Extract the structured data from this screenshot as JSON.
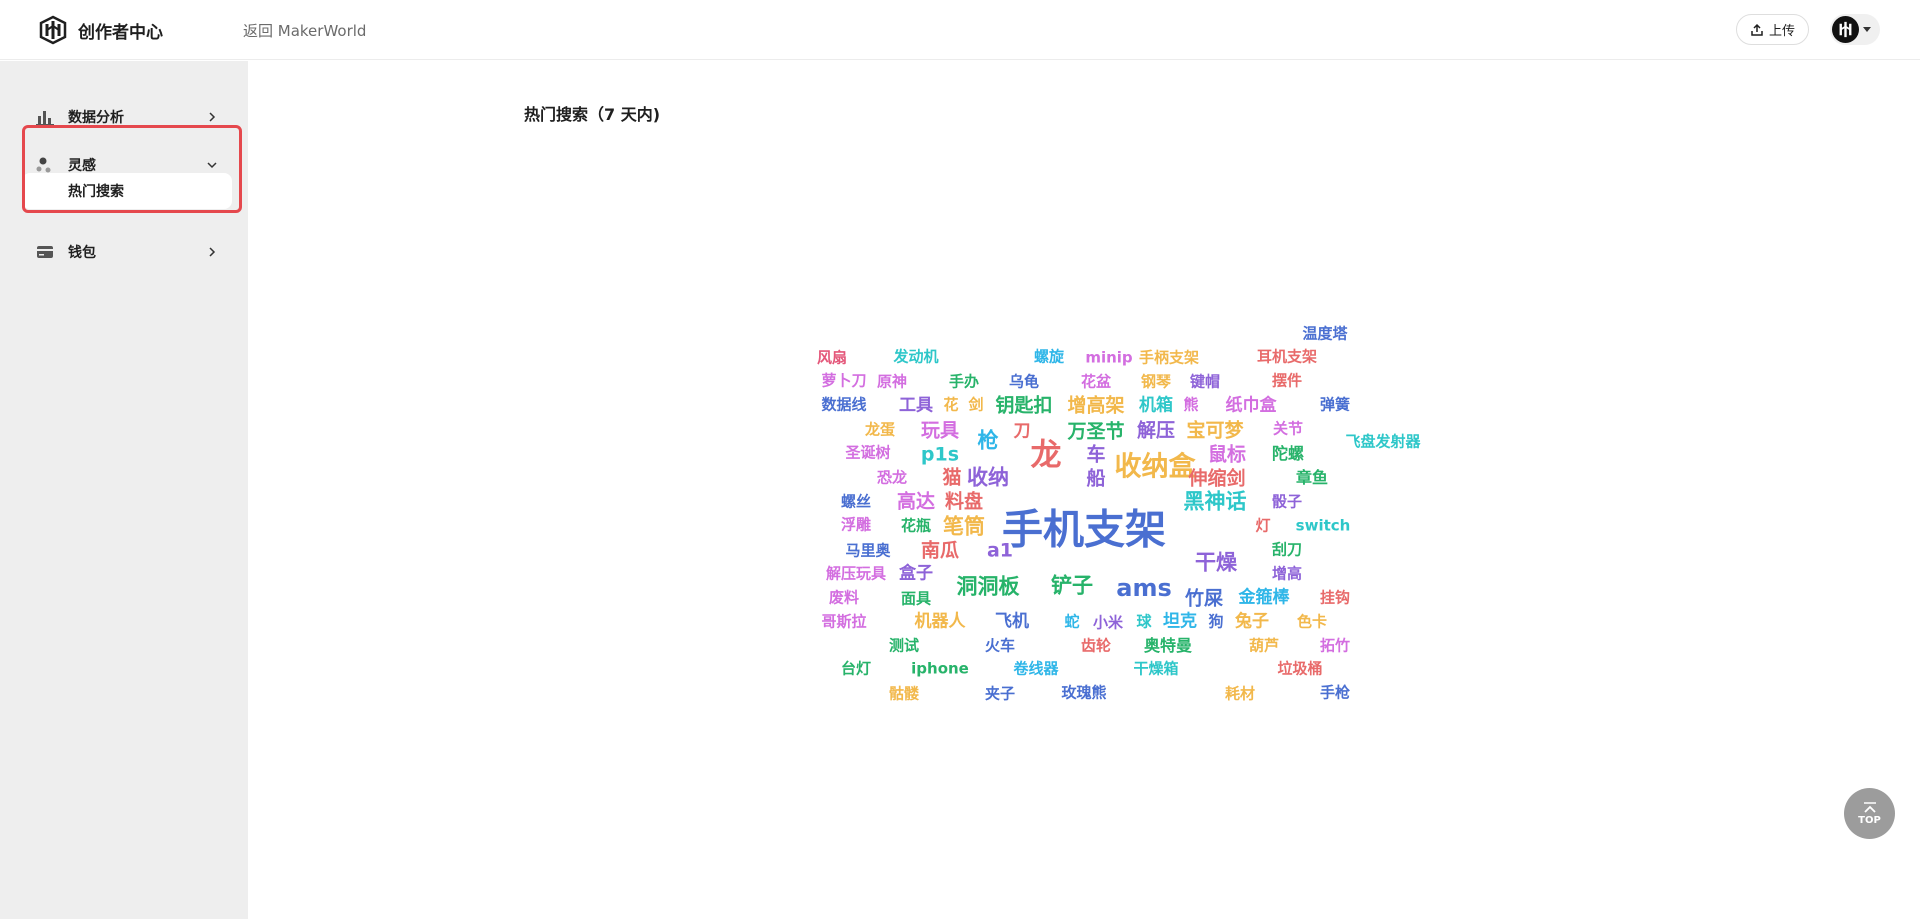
{
  "header": {
    "app_title": "创作者中心",
    "back_link": "返回 MakerWorld",
    "upload_label": "上传"
  },
  "sidebar": {
    "items": [
      {
        "label": "数据分析",
        "icon": "bar-chart-icon"
      },
      {
        "label": "灵感",
        "icon": "inspiration-icon",
        "expanded": true,
        "sub_items": [
          "热门搜索"
        ]
      },
      {
        "label": "钱包",
        "icon": "wallet-icon"
      }
    ]
  },
  "main": {
    "title": "热门搜索（7 天内)"
  },
  "word_cloud": {
    "words": [
      {
        "text": "温度塔",
        "color": "#4a6fd1"
      },
      {
        "text": "风扇",
        "color": "#e4577a"
      },
      {
        "text": "发动机",
        "color": "#2ec7c9"
      },
      {
        "text": "螺旋",
        "color": "#2fb6e8"
      },
      {
        "text": "minip",
        "color": "#d36ee0"
      },
      {
        "text": "手柄支架",
        "color": "#f2b84b"
      },
      {
        "text": "耳机支架",
        "color": "#e86a6a"
      },
      {
        "text": "萝卜刀",
        "color": "#d36ee0"
      },
      {
        "text": "原神",
        "color": "#d36ee0"
      },
      {
        "text": "手办",
        "color": "#27b36a"
      },
      {
        "text": "乌龟",
        "color": "#4a6fd1"
      },
      {
        "text": "花盆",
        "color": "#d36ee0"
      },
      {
        "text": "钢琴",
        "color": "#f2b84b"
      },
      {
        "text": "键帽",
        "color": "#8e63d8"
      },
      {
        "text": "摆件",
        "color": "#e86a6a"
      },
      {
        "text": "数据线",
        "color": "#4a6fd1"
      },
      {
        "text": "工具",
        "color": "#8e63d8"
      },
      {
        "text": "花",
        "color": "#f2b84b"
      },
      {
        "text": "剑",
        "color": "#f2b84b"
      },
      {
        "text": "钥匙扣",
        "color": "#27b36a"
      },
      {
        "text": "增高架",
        "color": "#f2b84b"
      },
      {
        "text": "机箱",
        "color": "#2ec7c9"
      },
      {
        "text": "熊",
        "color": "#d36ee0"
      },
      {
        "text": "纸巾盒",
        "color": "#d36ee0"
      },
      {
        "text": "弹簧",
        "color": "#4a6fd1"
      },
      {
        "text": "龙蛋",
        "color": "#f2b84b"
      },
      {
        "text": "玩具",
        "color": "#d36ee0"
      },
      {
        "text": "刀",
        "color": "#e86a6a"
      },
      {
        "text": "枪",
        "color": "#2fb6e8"
      },
      {
        "text": "万圣节",
        "color": "#27b36a"
      },
      {
        "text": "解压",
        "color": "#8e63d8"
      },
      {
        "text": "宝可梦",
        "color": "#f2b84b"
      },
      {
        "text": "关节",
        "color": "#d36ee0"
      },
      {
        "text": "飞盘发射器",
        "color": "#2ec7c9"
      },
      {
        "text": "圣诞树",
        "color": "#d36ee0"
      },
      {
        "text": "p1s",
        "color": "#2ec7c9"
      },
      {
        "text": "龙",
        "color": "#e86a6a"
      },
      {
        "text": "车",
        "color": "#8e63d8"
      },
      {
        "text": "收纳盒",
        "color": "#f2b84b"
      },
      {
        "text": "鼠标",
        "color": "#d36ee0"
      },
      {
        "text": "陀螺",
        "color": "#27b36a"
      },
      {
        "text": "恐龙",
        "color": "#d36ee0"
      },
      {
        "text": "猫",
        "color": "#e86a6a"
      },
      {
        "text": "收纳",
        "color": "#8e63d8"
      },
      {
        "text": "船",
        "color": "#8e63d8"
      },
      {
        "text": "伸缩剑",
        "color": "#e86a6a"
      },
      {
        "text": "章鱼",
        "color": "#27b36a"
      },
      {
        "text": "螺丝",
        "color": "#4a6fd1"
      },
      {
        "text": "高达",
        "color": "#d36ee0"
      },
      {
        "text": "料盘",
        "color": "#e86a6a"
      },
      {
        "text": "黑神话",
        "color": "#2ec7c9"
      },
      {
        "text": "骰子",
        "color": "#8e63d8"
      },
      {
        "text": "浮雕",
        "color": "#d36ee0"
      },
      {
        "text": "花瓶",
        "color": "#27b36a"
      },
      {
        "text": "笔筒",
        "color": "#f2b84b"
      },
      {
        "text": "手机支架",
        "color": "#4a6fd1"
      },
      {
        "text": "灯",
        "color": "#e86a6a"
      },
      {
        "text": "switch",
        "color": "#2ec7c9"
      },
      {
        "text": "马里奥",
        "color": "#4a6fd1"
      },
      {
        "text": "南瓜",
        "color": "#e86a6a"
      },
      {
        "text": "a1",
        "color": "#8e63d8"
      },
      {
        "text": "干燥",
        "color": "#8e63d8"
      },
      {
        "text": "刮刀",
        "color": "#27b36a"
      },
      {
        "text": "解压玩具",
        "color": "#d36ee0"
      },
      {
        "text": "盒子",
        "color": "#8e63d8"
      },
      {
        "text": "洞洞板",
        "color": "#27b36a"
      },
      {
        "text": "铲子",
        "color": "#27b36a"
      },
      {
        "text": "ams",
        "color": "#4a6fd1"
      },
      {
        "text": "增高",
        "color": "#8e63d8"
      },
      {
        "text": "废料",
        "color": "#d36ee0"
      },
      {
        "text": "面具",
        "color": "#27b36a"
      },
      {
        "text": "竹屎",
        "color": "#4a6fd1"
      },
      {
        "text": "金箍棒",
        "color": "#2fb6e8"
      },
      {
        "text": "挂钩",
        "color": "#e86a6a"
      },
      {
        "text": "哥斯拉",
        "color": "#d36ee0"
      },
      {
        "text": "机器人",
        "color": "#f2b84b"
      },
      {
        "text": "飞机",
        "color": "#4a6fd1"
      },
      {
        "text": "蛇",
        "color": "#2fb6e8"
      },
      {
        "text": "小米",
        "color": "#8e63d8"
      },
      {
        "text": "球",
        "color": "#2ec7c9"
      },
      {
        "text": "坦克",
        "color": "#2fb6e8"
      },
      {
        "text": "狗",
        "color": "#4a6fd1"
      },
      {
        "text": "兔子",
        "color": "#f2b84b"
      },
      {
        "text": "色卡",
        "color": "#f2b84b"
      },
      {
        "text": "测试",
        "color": "#27b36a"
      },
      {
        "text": "火车",
        "color": "#4a6fd1"
      },
      {
        "text": "齿轮",
        "color": "#e86a6a"
      },
      {
        "text": "奥特曼",
        "color": "#27b36a"
      },
      {
        "text": "葫芦",
        "color": "#f2b84b"
      },
      {
        "text": "拓竹",
        "color": "#d36ee0"
      },
      {
        "text": "台灯",
        "color": "#27b36a"
      },
      {
        "text": "iphone",
        "color": "#27b36a"
      },
      {
        "text": "卷线器",
        "color": "#2fb6e8"
      },
      {
        "text": "干燥箱",
        "color": "#2ec7c9"
      },
      {
        "text": "垃圾桶",
        "color": "#e86a6a"
      },
      {
        "text": "骷髅",
        "color": "#f2b84b"
      },
      {
        "text": "夹子",
        "color": "#4a6fd1"
      },
      {
        "text": "玫瑰熊",
        "color": "#4a6fd1"
      },
      {
        "text": "耗材",
        "color": "#f2b84b"
      },
      {
        "text": "手枪",
        "color": "#4a6fd1"
      }
    ]
  },
  "back_to_top": {
    "label": "TOP"
  }
}
